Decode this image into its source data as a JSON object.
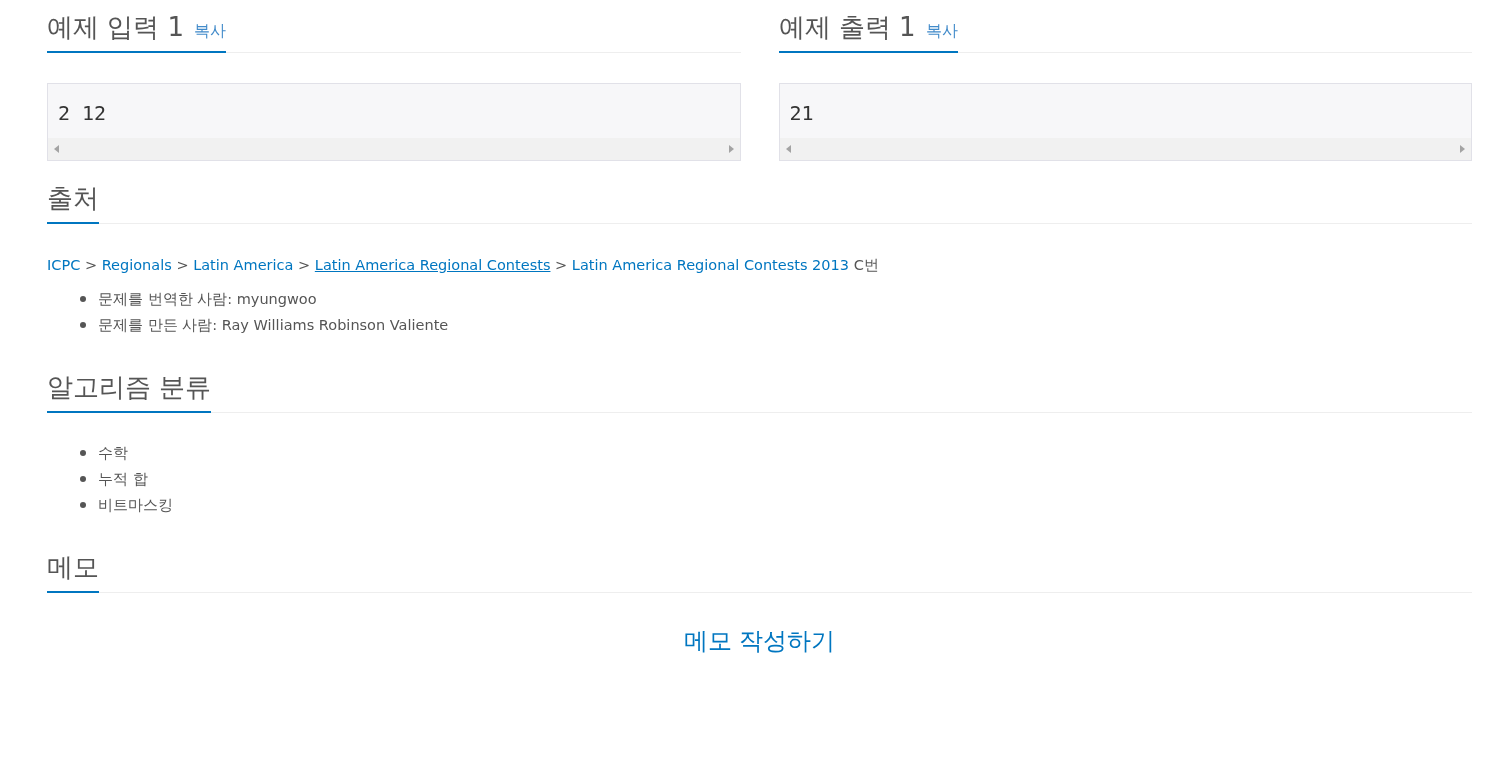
{
  "samples": [
    {
      "title": "예제 입력 1",
      "copy_label": "복사",
      "content": "2 12"
    },
    {
      "title": "예제 출력 1",
      "copy_label": "복사",
      "content": "21"
    }
  ],
  "source": {
    "title": "출처",
    "breadcrumb": [
      {
        "kind": "link",
        "text": "ICPC",
        "underlined": false
      },
      {
        "kind": "separator",
        "text": ">"
      },
      {
        "kind": "link",
        "text": "Regionals",
        "underlined": false
      },
      {
        "kind": "separator",
        "text": ">"
      },
      {
        "kind": "link",
        "text": "Latin America",
        "underlined": false
      },
      {
        "kind": "separator",
        "text": ">"
      },
      {
        "kind": "link",
        "text": "Latin America Regional Contests",
        "underlined": true
      },
      {
        "kind": "separator",
        "text": ">"
      },
      {
        "kind": "link",
        "text": "Latin America Regional Contests 2013",
        "underlined": false
      },
      {
        "kind": "plain",
        "text": "C번"
      }
    ],
    "credits": [
      "문제를 번역한 사람: myungwoo",
      "문제를 만든 사람: Ray Williams Robinson Valiente"
    ]
  },
  "algorithms": {
    "title": "알고리즘 분류",
    "items": [
      "수학",
      "누적 합",
      "비트마스킹"
    ]
  },
  "memo": {
    "title": "메모",
    "action": "메모 작성하기"
  }
}
